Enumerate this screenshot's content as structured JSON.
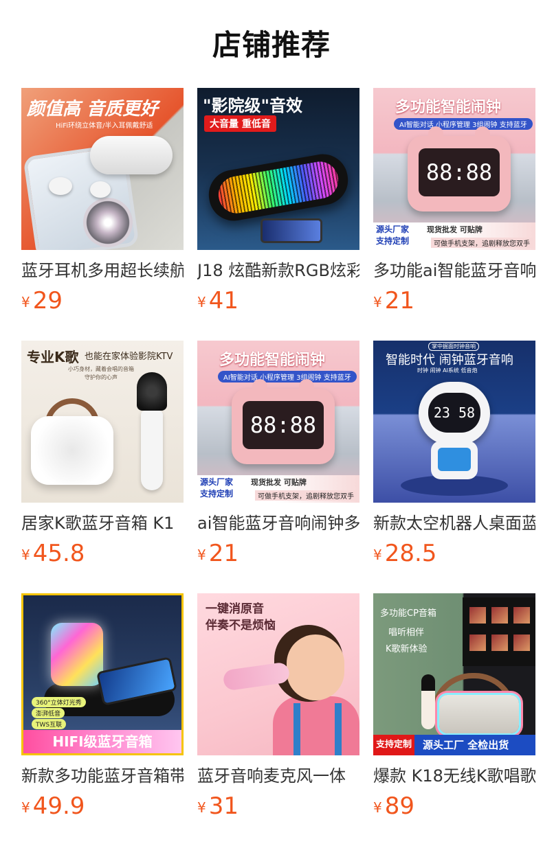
{
  "page": {
    "title": "店铺推荐"
  },
  "currency_symbol": "¥",
  "products": [
    {
      "name": "蓝牙耳机多用超长续航",
      "price": "29",
      "image_text": [
        "颜值高 音质更好",
        "HiFi环绕立体音/半入耳佩戴舒适"
      ]
    },
    {
      "name": "J18 炫酷新款RGB炫彩",
      "price": "41",
      "image_text": [
        "\"影院级\"音效",
        "大音量 重低音"
      ]
    },
    {
      "name": "多功能ai智能蓝牙音响",
      "price": "21",
      "image_text": [
        "多功能智能闹钟",
        "AI智能对话 小程序管理 3组闹钟 支持蓝牙",
        "88:88",
        "源头厂家",
        "支持定制",
        "现货批发 可贴牌",
        "可做手机支架，追剧释放您双手"
      ]
    },
    {
      "name": "居家K歌蓝牙音箱 K1",
      "price": "45.8",
      "image_text": [
        "专业K歌",
        "也能在家体验影院KTV",
        "小巧身材，藏着会唱的音箱",
        "守护你的心声"
      ]
    },
    {
      "name": "ai智能蓝牙音响闹钟多",
      "price": "21",
      "image_text": [
        "多功能智能闹钟",
        "AI智能对话 小程序管理 3组闹钟 支持蓝牙",
        "88:88",
        "源头厂家",
        "支持定制",
        "现货批发 可贴牌",
        "可做手机支架，追剧释放您双手"
      ]
    },
    {
      "name": "新款太空机器人桌面蓝",
      "price": "28.5",
      "image_text": [
        "掌中掘面时钟音响",
        "智能时代 闹钟蓝牙音响",
        "时钟 闹钟 AI系统 低音炮",
        "23 58"
      ]
    },
    {
      "name": "新款多功能蓝牙音箱带",
      "price": "49.9",
      "image_text": [
        "360°立体灯光秀",
        "澎湃低音",
        "TWS互联",
        "HIFI级蓝牙音箱"
      ]
    },
    {
      "name": "蓝牙音响麦克风一体",
      "price": "31",
      "image_text": [
        "一键消原音",
        "伴奏不是烦恼"
      ]
    },
    {
      "name": "爆款 K18无线K歌唱歌",
      "price": "89",
      "image_text": [
        "多功能CP音箱",
        "唱听相伴",
        "K歌新体验",
        "支持定制",
        "源头工厂 全检出货"
      ]
    }
  ],
  "colors": {
    "price": "#f1561d",
    "title": "#111111",
    "product_name": "#333333"
  },
  "icons": {
    "currency": "yen-sign"
  }
}
